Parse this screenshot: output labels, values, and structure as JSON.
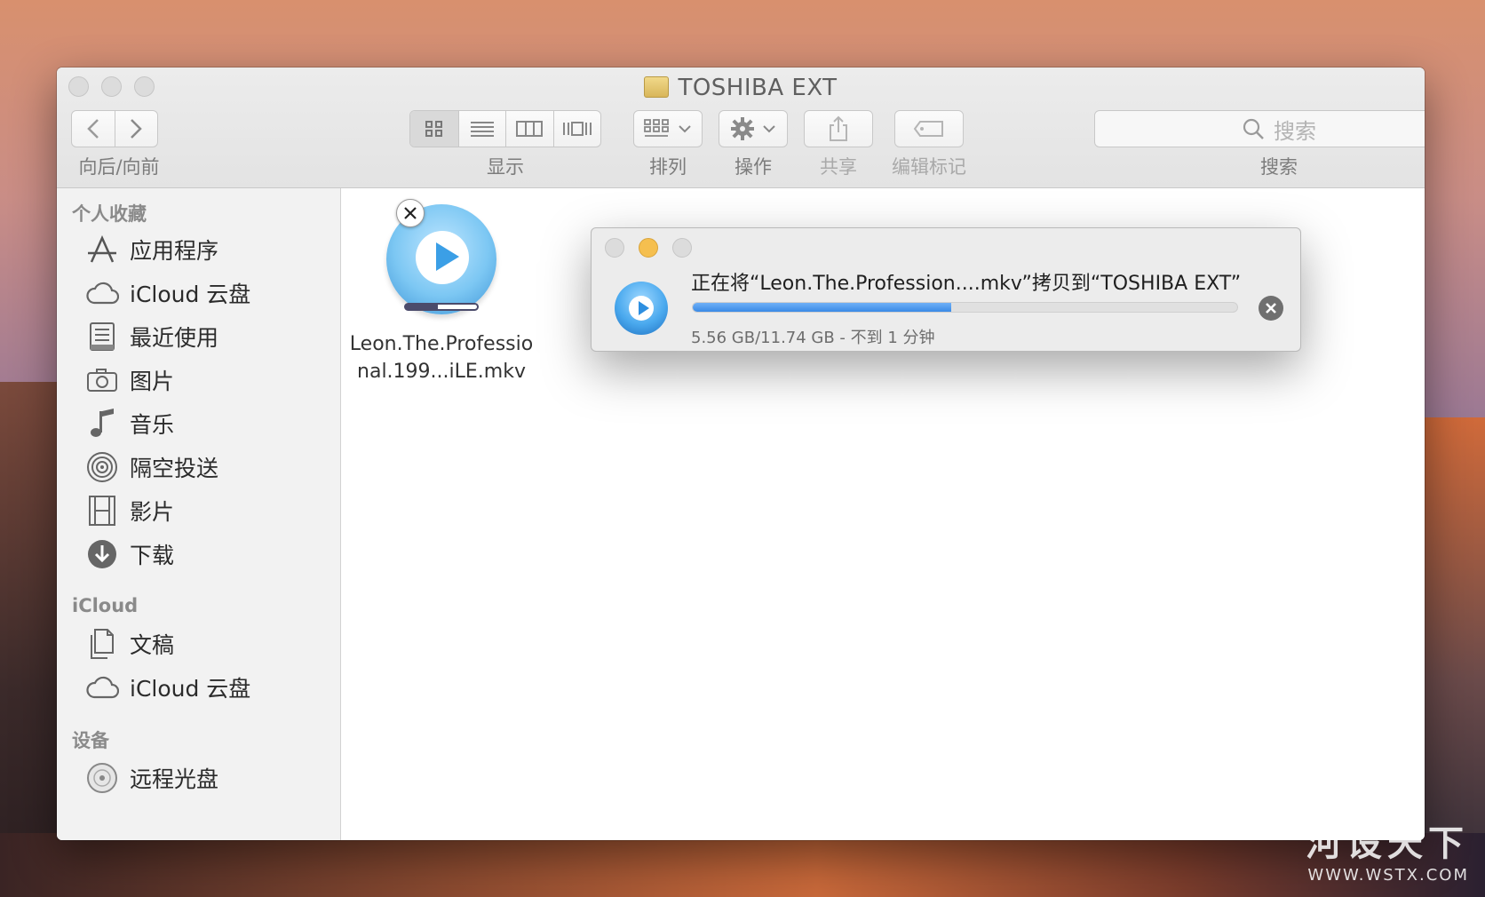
{
  "window": {
    "title": "TOSHIBA EXT"
  },
  "toolbar": {
    "nav_label": "向后/向前",
    "view_label": "显示",
    "arrange_label": "排列",
    "action_label": "操作",
    "share_label": "共享",
    "tags_label": "编辑标记",
    "search_label": "搜索",
    "search_placeholder": "搜索"
  },
  "sidebar": {
    "sections": [
      {
        "heading": "个人收藏",
        "items": [
          {
            "label": "应用程序",
            "icon": "applications-icon"
          },
          {
            "label": "iCloud 云盘",
            "icon": "cloud-icon"
          },
          {
            "label": "最近使用",
            "icon": "recents-icon"
          },
          {
            "label": "图片",
            "icon": "camera-icon"
          },
          {
            "label": "音乐",
            "icon": "music-note-icon"
          },
          {
            "label": "隔空投送",
            "icon": "airdrop-icon"
          },
          {
            "label": "影片",
            "icon": "film-icon"
          },
          {
            "label": "下载",
            "icon": "download-icon"
          }
        ]
      },
      {
        "heading": "iCloud",
        "items": [
          {
            "label": "文稿",
            "icon": "documents-icon"
          },
          {
            "label": "iCloud 云盘",
            "icon": "cloud-icon"
          }
        ]
      },
      {
        "heading": "设备",
        "items": [
          {
            "label": "远程光盘",
            "icon": "disc-icon"
          }
        ]
      }
    ]
  },
  "file": {
    "name": "Leon.The.Professional.199...iLE.mkv",
    "copy_progress": 0.45
  },
  "copy_dialog": {
    "title": "正在将“Leon.The.Profession....mkv”拷贝到“TOSHIBA EXT”",
    "status": "5.56 GB/11.74 GB - 不到 1 分钟",
    "progress": 0.474
  },
  "colors": {
    "progress_fill": "#3a8ae6",
    "close_yellow": "#f5bf4f"
  },
  "watermark": {
    "main": "河设天下",
    "url": "WWW.WSTX.COM"
  }
}
